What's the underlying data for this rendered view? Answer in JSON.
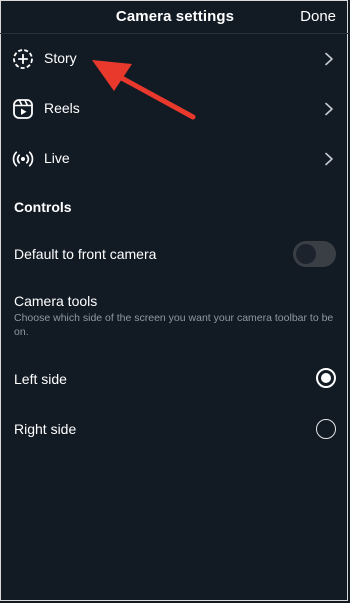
{
  "header": {
    "title": "Camera settings",
    "done_label": "Done"
  },
  "camera_modes": [
    {
      "label": "Story",
      "icon": "story-add-icon"
    },
    {
      "label": "Reels",
      "icon": "reels-icon"
    },
    {
      "label": "Live",
      "icon": "live-broadcast-icon"
    }
  ],
  "controls": {
    "section_title": "Controls",
    "front_camera": {
      "label": "Default to front camera",
      "enabled": false
    },
    "camera_tools": {
      "label": "Camera tools",
      "description": "Choose which side of the screen you want your camera toolbar to be on.",
      "options": [
        {
          "label": "Left side",
          "selected": true
        },
        {
          "label": "Right side",
          "selected": false
        }
      ]
    }
  },
  "colors": {
    "background": "#121a24",
    "annotation_arrow": "#e8392c"
  }
}
